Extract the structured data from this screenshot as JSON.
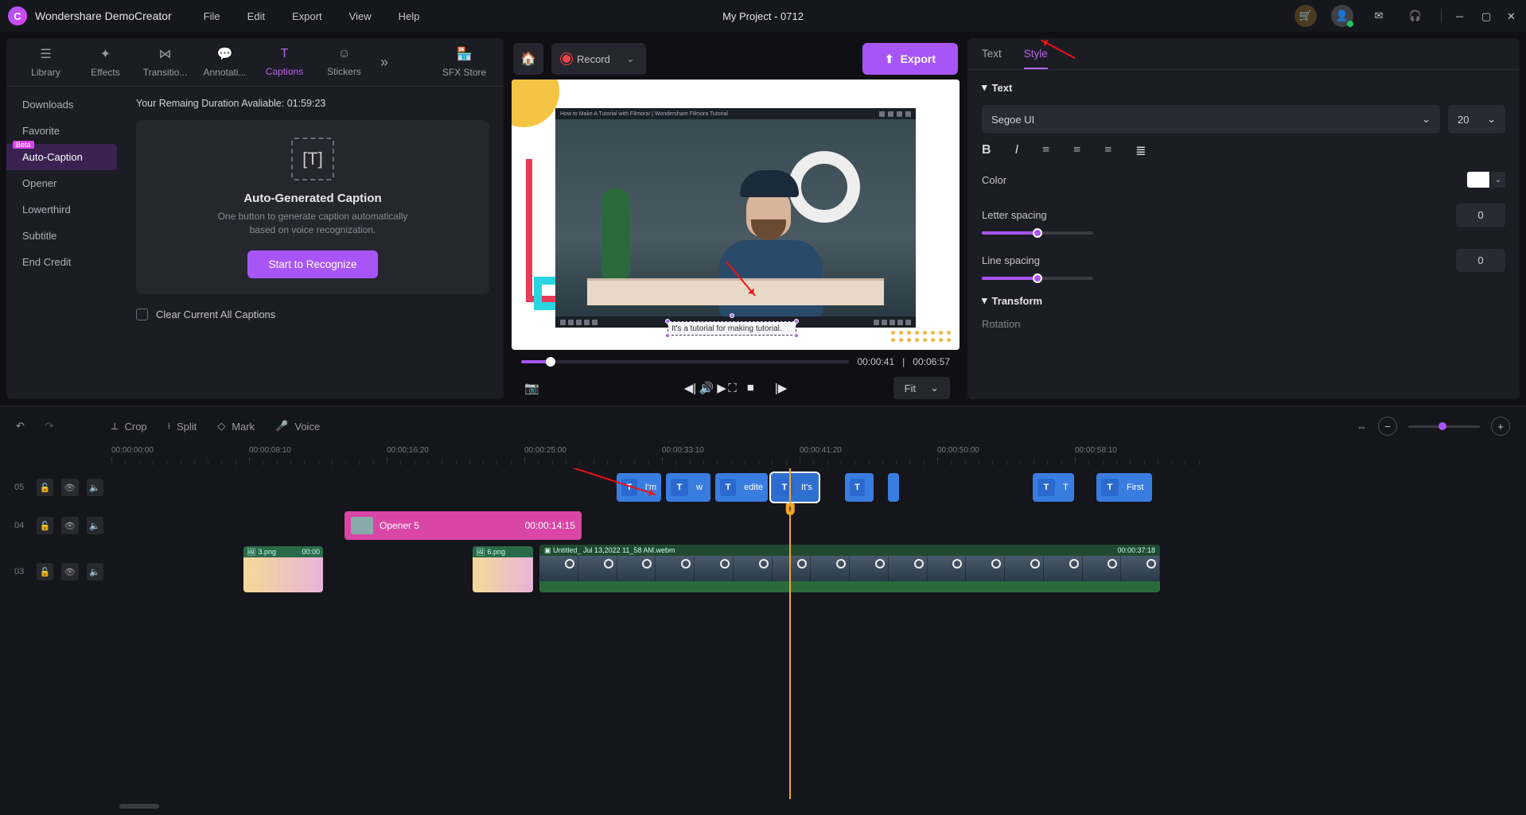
{
  "app": {
    "name": "Wondershare DemoCreator",
    "project_title": "My Project - 0712"
  },
  "menubar": {
    "file": "File",
    "edit": "Edit",
    "export": "Export",
    "view": "View",
    "help": "Help"
  },
  "main_tabs": {
    "library": "Library",
    "effects": "Effects",
    "transitions": "Transitio...",
    "annotations": "Annotati...",
    "captions": "Captions",
    "stickers": "Stickers",
    "sfx": "SFX Store"
  },
  "categories": {
    "downloads": "Downloads",
    "favorite": "Favorite",
    "auto_caption": "Auto-Caption",
    "opener": "Opener",
    "lowerthird": "Lowerthird",
    "subtitle": "Subtitle",
    "end_credit": "End Credit",
    "beta_label": "Beta"
  },
  "caption_panel": {
    "remaining": "Your Remaing Duration Avaliable: 01:59:23",
    "card_title": "Auto-Generated Caption",
    "card_desc": "One button to generate caption automatically based on voice recognization.",
    "recognize_btn": "Start to Recognize",
    "clear_label": "Clear Current All Captions"
  },
  "preview": {
    "record_label": "Record",
    "export_label": "Export",
    "video_title": "How to Make A Tutorial with Filmora! | Wondershare Filmora Tutorial",
    "caption_text": "It's a tutorial for making tutorial.",
    "time_current": "00:00:41",
    "time_total": "00:06:57",
    "fit_label": "Fit"
  },
  "props": {
    "tab_text": "Text",
    "tab_style": "Style",
    "section_text": "Text",
    "section_transform": "Transform",
    "font": "Segoe UI",
    "font_size": "20",
    "color_label": "Color",
    "letter_spacing_label": "Letter spacing",
    "letter_spacing_val": "0",
    "line_spacing_label": "Line spacing",
    "line_spacing_val": "0",
    "rotation_label": "Rotation"
  },
  "tl_tools": {
    "crop": "Crop",
    "split": "Split",
    "mark": "Mark",
    "voice": "Voice"
  },
  "ruler": [
    "00:00:00:00",
    "00:00:08:10",
    "00:00:16:20",
    "00:00:25:00",
    "00:00:33:10",
    "00:00:41:20",
    "00:00:50:00",
    "00:00:58:10"
  ],
  "tracks": {
    "t5": "05",
    "t4": "04",
    "t3": "03"
  },
  "clips": {
    "text_items": [
      "I'm",
      "w",
      "edite",
      "It's",
      "",
      "",
      "T",
      "First"
    ],
    "opener_label": "Opener 5",
    "opener_dur": "00:00:14:15",
    "img1": "3.png",
    "img1_dur": "00:00",
    "img2": "6.png",
    "video_name": "Untitled_ Jul 13,2022 11_58 AM.webm",
    "video_dur": "00:00:37:18"
  }
}
